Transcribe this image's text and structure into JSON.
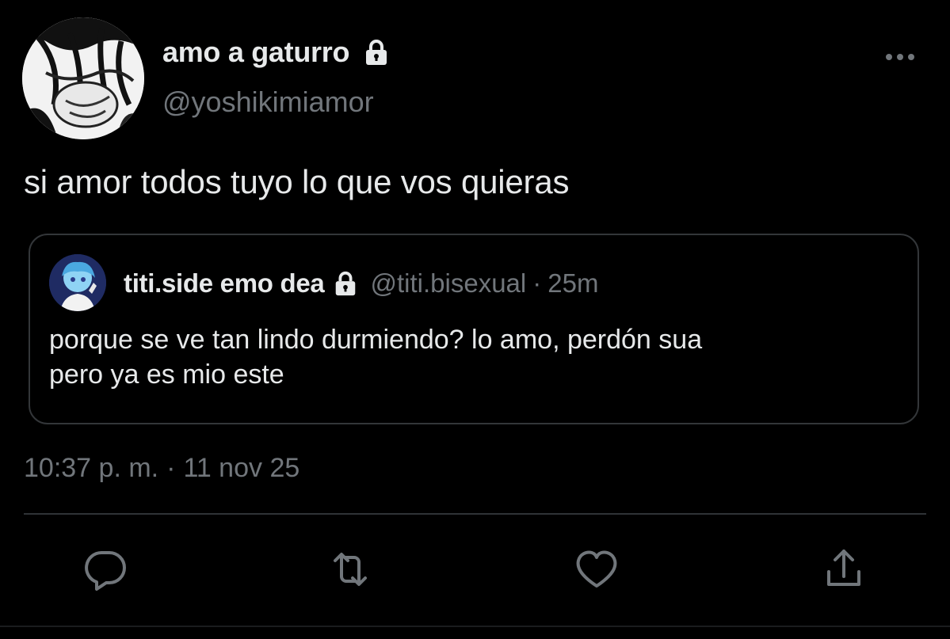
{
  "author": {
    "display_name": "amo a gaturro",
    "handle": "@yoshikimiamor",
    "avatar_icon": "manga-avatar",
    "protected_icon": "lock-icon"
  },
  "tweet": {
    "text": "si amor todos tuyo lo que vos quieras"
  },
  "quoted_tweet": {
    "display_name": "titi.side emo dea",
    "handle": "@titi.bisexual",
    "separator": "·",
    "time": "25m",
    "text_line_1": "porque se ve tan lindo durmiendo? lo amo, perdón sua",
    "text_line_2": "pero ya es mio este",
    "avatar_icon": "anime-avatar",
    "protected_icon": "lock-icon"
  },
  "timestamp": {
    "time": "10:37 p. m.",
    "separator": "·",
    "date": "11 nov 25"
  },
  "actions": {
    "reply_icon": "reply-icon",
    "retweet_icon": "retweet-icon",
    "like_icon": "heart-icon",
    "share_icon": "share-icon",
    "more_icon": "more-dots-icon"
  },
  "colors": {
    "background": "#000000",
    "primary_text": "#e7e9ea",
    "secondary_text": "#71767b",
    "border": "#333639"
  }
}
